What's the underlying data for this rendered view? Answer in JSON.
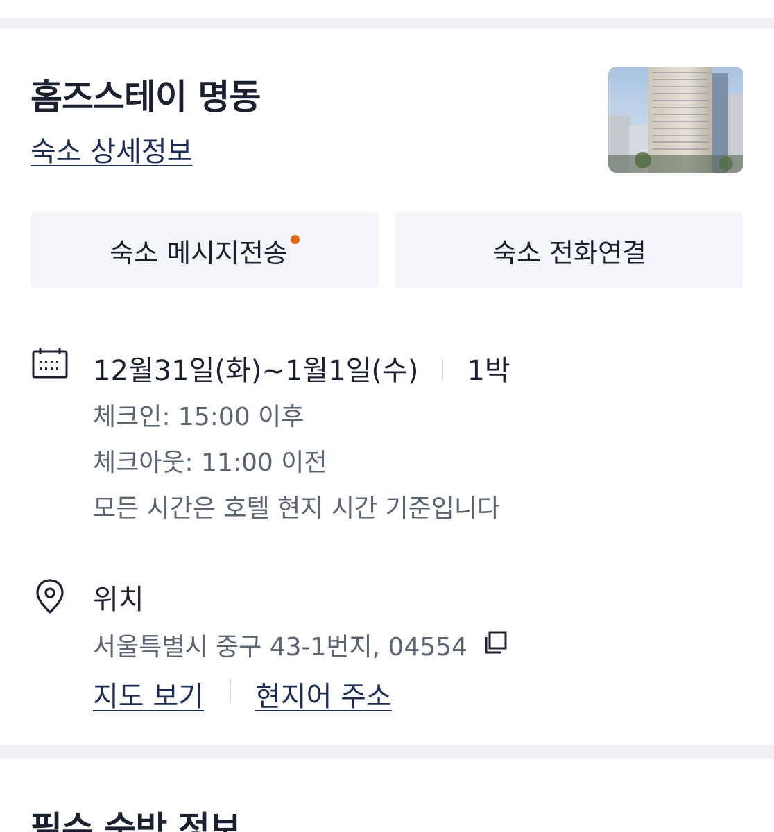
{
  "header": {
    "hotel_name": "홈즈스테이 명동",
    "detail_link": "숙소 상세정보",
    "thumbnail_alt": "hotel-building-photo"
  },
  "actions": {
    "message_button": "숙소 메시지전송",
    "call_button": "숙소 전화연결",
    "notification_color": "#e8650c"
  },
  "stay": {
    "icon": "calendar-icon",
    "dates": "12월31일(화)~1월1일(수)",
    "nights": "1박",
    "check_in": "체크인: 15:00 이후",
    "check_out": "체크아웃: 11:00 이전",
    "timezone_note": "모든 시간은 호텔 현지 시간 기준입니다"
  },
  "location": {
    "icon": "location-pin-icon",
    "title": "위치",
    "address": "서울특별시 중구 43-1번지, 04554",
    "copy_icon": "copy-icon",
    "map_link": "지도 보기",
    "local_address_link": "현지어 주소"
  },
  "next_section": {
    "title": "필수 숙박 정보"
  },
  "colors": {
    "primary_text": "#1a2030",
    "secondary_text": "#5b6472",
    "link": "#1a2b55",
    "button_bg": "#f3f5f8",
    "divider": "#eef0f3"
  }
}
